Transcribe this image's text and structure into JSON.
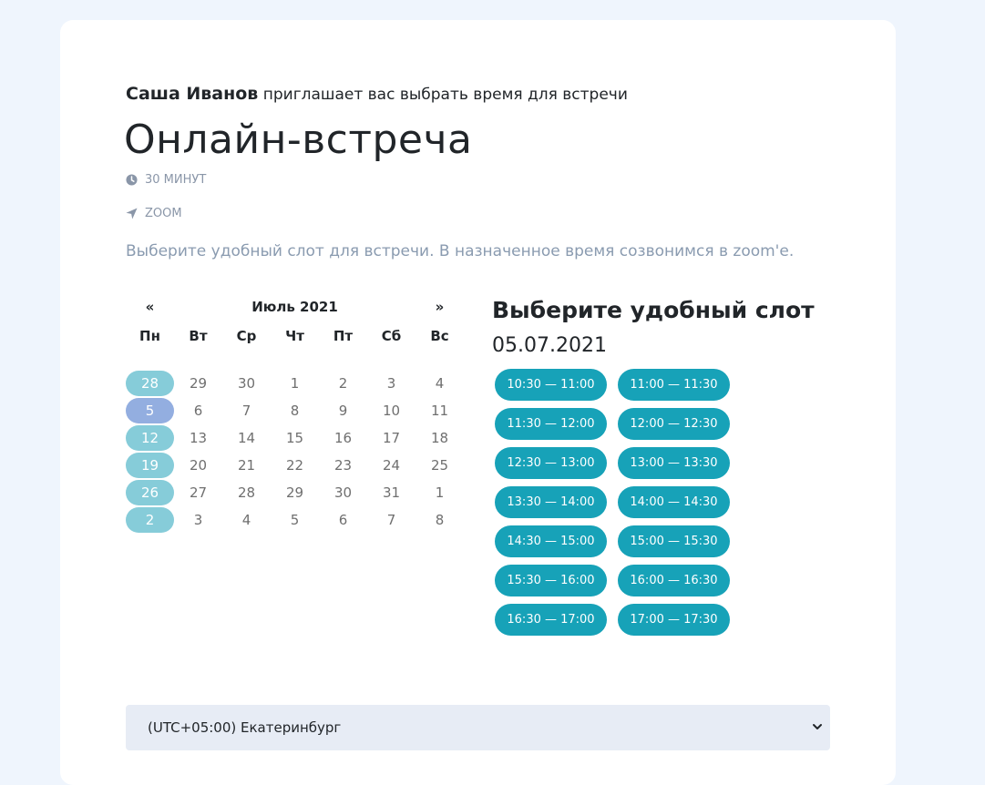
{
  "header": {
    "host_name": "Саша Иванов",
    "invite_text": "приглашает вас выбрать время для встречи",
    "event_title": "Онлайн-встреча",
    "duration": "30 минут",
    "location": "zoom",
    "description": "Выберите удобный слот для встречи. В назначенное время созвонимся в zoom'е."
  },
  "calendar": {
    "prev": "«",
    "next": "»",
    "month": "Июль 2021",
    "weekdays": [
      "Пн",
      "Вт",
      "Ср",
      "Чт",
      "Пт",
      "Сб",
      "Вс"
    ],
    "weeks": [
      [
        "28",
        "29",
        "30",
        "1",
        "2",
        "3",
        "4"
      ],
      [
        "5",
        "6",
        "7",
        "8",
        "9",
        "10",
        "11"
      ],
      [
        "12",
        "13",
        "14",
        "15",
        "16",
        "17",
        "18"
      ],
      [
        "19",
        "20",
        "21",
        "22",
        "23",
        "24",
        "25"
      ],
      [
        "26",
        "27",
        "28",
        "29",
        "30",
        "31",
        "1"
      ],
      [
        "2",
        "3",
        "4",
        "5",
        "6",
        "7",
        "8"
      ]
    ],
    "selected_day": "5",
    "highlighted_column": "Пн"
  },
  "slots": {
    "title": "Выберите удобный слот",
    "date": "05.07.2021",
    "items": [
      "10:30 — 11:00",
      "11:00 — 11:30",
      "11:30 — 12:00",
      "12:00 — 12:30",
      "12:30 — 13:00",
      "13:00 — 13:30",
      "13:30 — 14:00",
      "14:00 — 14:30",
      "14:30 — 15:00",
      "15:00 — 15:30",
      "15:30 — 16:00",
      "16:00 — 16:30",
      "16:30 — 17:00",
      "17:00 — 17:30"
    ]
  },
  "timezone": {
    "selected": "(UTC+05:00) Екатеринбург"
  },
  "colors": {
    "page_bg": "#eff5fd",
    "slot_bg": "#17a2b8",
    "day_highlight": "#86ccd9",
    "day_selected": "#93aee0",
    "muted_text": "#8a96a8"
  },
  "icons": {
    "duration": "clock-icon",
    "location": "location-arrow-icon",
    "select": "chevron-down-icon"
  }
}
